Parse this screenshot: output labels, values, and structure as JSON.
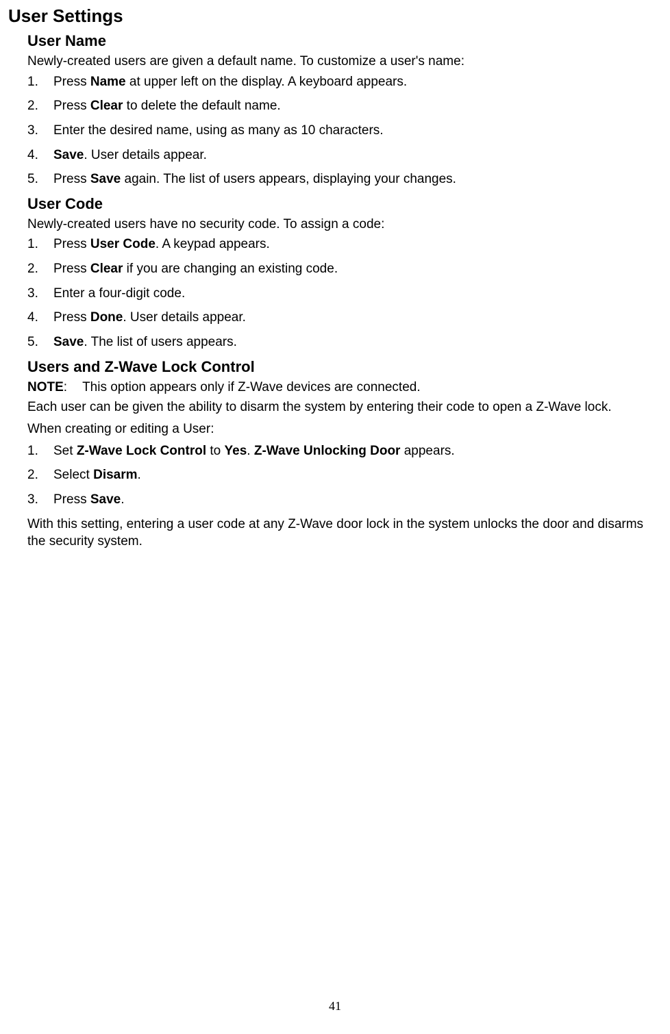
{
  "title": "User Settings",
  "userName": {
    "heading": "User Name",
    "intro": "Newly-created users are given a default name. To customize a user's name:",
    "steps": {
      "s1_a": "Press ",
      "s1_b": "Name",
      "s1_c": " at upper left on the display. A keyboard appears.",
      "s2_a": "Press ",
      "s2_b": "Clear",
      "s2_c": " to delete the default name.",
      "s3": "Enter the desired name, using as many as 10 characters.",
      "s4_a": "Save",
      "s4_b": ". User details appear.",
      "s5_a": "Press ",
      "s5_b": "Save",
      "s5_c": " again. The list of users appears, displaying your changes."
    }
  },
  "userCode": {
    "heading": "User Code",
    "intro": "Newly-created users have no security code. To assign a code:",
    "steps": {
      "s1_a": "Press ",
      "s1_b": "User Code",
      "s1_c": ". A keypad appears.",
      "s2_a": "Press ",
      "s2_b": "Clear",
      "s2_c": " if you are changing an existing code.",
      "s3": "Enter a four-digit code.",
      "s4_a": "Press ",
      "s4_b": "Done",
      "s4_c": ". User details appear.",
      "s5_a": "Save",
      "s5_b": ". The list of users appears."
    }
  },
  "zwave": {
    "heading": "Users and Z-Wave Lock Control",
    "noteLabel": "NOTE",
    "noteColon": ":",
    "noteText": "This option appears only if Z-Wave devices are connected.",
    "para1": "Each user can be given the ability to disarm the system by entering their code to open a Z-Wave lock.",
    "para2": "When creating or editing a User:",
    "steps": {
      "s1_a": "Set ",
      "s1_b": "Z-Wave Lock Control",
      "s1_c": " to ",
      "s1_d": "Yes",
      "s1_e": ". ",
      "s1_f": "Z-Wave Unlocking Door",
      "s1_g": " appears.",
      "s2_a": "Select ",
      "s2_b": "Disarm",
      "s2_c": ".",
      "s3_a": "Press ",
      "s3_b": "Save",
      "s3_c": "."
    },
    "para3": "With this setting, entering a user code at any Z-Wave door lock in the system unlocks the door and disarms the security system."
  },
  "pageNumber": "41"
}
